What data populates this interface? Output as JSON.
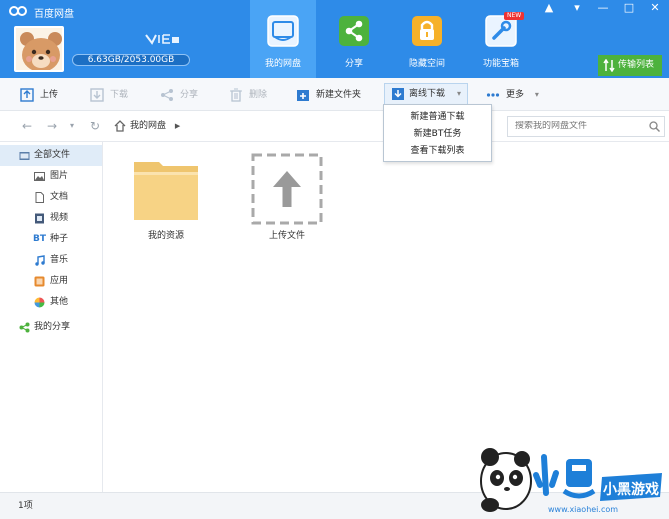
{
  "app": {
    "title": "百度网盘",
    "storage": "6.63GB/2053.00GB",
    "window_controls": [
      "▲",
      "▾",
      "—",
      "□",
      "✕"
    ]
  },
  "nav_tabs": [
    {
      "label": "我的网盘",
      "icon": "cloud-icon",
      "active": true
    },
    {
      "label": "分享",
      "icon": "share-icon",
      "active": false
    },
    {
      "label": "隐藏空间",
      "icon": "lock-icon",
      "active": false
    },
    {
      "label": "功能宝箱",
      "icon": "toolbox-icon",
      "active": false,
      "badge": "NEW"
    }
  ],
  "transfer_button": "传输列表",
  "toolbar": {
    "upload": "上传",
    "download": "下载",
    "share": "分享",
    "delete": "删除",
    "new_folder": "新建文件夹",
    "offline_download": "离线下载",
    "more": "更多"
  },
  "dropdown": {
    "items": [
      "新建普通下载",
      "新建BT任务",
      "查看下载列表"
    ]
  },
  "address": {
    "path": "我的网盘",
    "search_placeholder": "搜索我的网盘文件"
  },
  "sidebar": {
    "items": [
      {
        "label": "全部文件",
        "icon": "folder-icon",
        "selected": true
      },
      {
        "label": "图片",
        "icon": "image-icon"
      },
      {
        "label": "文档",
        "icon": "document-icon"
      },
      {
        "label": "视频",
        "icon": "video-icon"
      },
      {
        "label": "种子",
        "icon": "bt-icon",
        "icon_text": "BT"
      },
      {
        "label": "音乐",
        "icon": "music-icon"
      },
      {
        "label": "应用",
        "icon": "app-icon"
      },
      {
        "label": "其他",
        "icon": "other-icon"
      },
      {
        "label": "我的分享",
        "icon": "share-icon"
      }
    ]
  },
  "files": [
    {
      "name": "我的资源",
      "type": "folder"
    },
    {
      "name": "上传文件",
      "type": "upload-placeholder"
    }
  ],
  "status": {
    "count": "1项"
  },
  "watermark": {
    "brand": "小黑游戏",
    "url": "www.xiaohei.com"
  },
  "colors": {
    "titlebar": "#2e8be8",
    "active_tab": "#4aa4f5",
    "transfer_green": "#4db23d",
    "folder_yellow": "#f7d385"
  }
}
